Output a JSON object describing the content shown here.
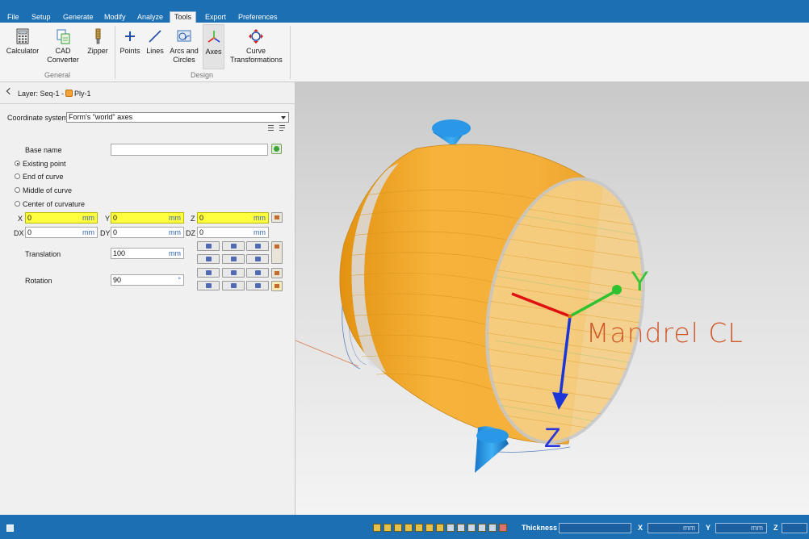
{
  "menu": [
    "File",
    "Setup",
    "Generate",
    "Modify",
    "Analyze",
    "Tools",
    "Export",
    "Preferences"
  ],
  "active_menu": "Tools",
  "ribbon": {
    "general": {
      "label": "General",
      "buttons": [
        {
          "label": "Calculator",
          "icon": "calculator-icon"
        },
        {
          "label": "CAD Converter",
          "icon": "cad-converter-icon"
        },
        {
          "label": "Zipper",
          "icon": "zipper-icon"
        }
      ]
    },
    "design": {
      "label": "Design",
      "buttons": [
        {
          "label": "Points",
          "icon": "plus-icon"
        },
        {
          "label": "Lines",
          "icon": "line-icon"
        },
        {
          "label": "Arcs and Circles",
          "icon": "arcs-icon"
        },
        {
          "label": "Axes",
          "icon": "axes-icon"
        },
        {
          "label": "Curve Transformations",
          "icon": "curve-transform-icon"
        }
      ]
    }
  },
  "breadcrumb": {
    "prefix": "Layer: Seq-1 -",
    "ply": "Ply-1"
  },
  "form": {
    "coord_label": "Coordinate system",
    "coord_value": "Form's \"world\" axes",
    "base_name_label": "Base name",
    "base_name_value": "",
    "options": [
      "Existing point",
      "End of curve",
      "Middle of curve",
      "Center of curvature"
    ],
    "selected_option": "Existing point",
    "x_label": "X",
    "x_value": "0",
    "y_label": "Y",
    "y_value": "0",
    "z_label": "Z",
    "z_value": "0",
    "dx_label": "DX",
    "dx_value": "0",
    "dy_label": "DY",
    "dy_value": "0",
    "dz_label": "DZ",
    "dz_value": "0",
    "unit": "mm",
    "translation_label": "Translation",
    "translation_value": "100",
    "rotation_label": "Rotation",
    "rotation_value": "90",
    "rotation_unit": "°"
  },
  "viewport": {
    "axis_y": "Y",
    "axis_z": "Z",
    "annotation": "Mandrel CL",
    "colors": {
      "mandrel": "#f4a823",
      "cone": "#1f8fe0",
      "x_axis": "#e11010",
      "y_axis": "#2ec22e",
      "z_axis": "#1b35d8",
      "annotation": "#d05a2a"
    }
  },
  "status": {
    "thickness_label": "Thickness",
    "thickness_value": "",
    "x_label": "X",
    "x_unit": "mm",
    "y_label": "Y",
    "y_unit": "mm",
    "z_label": "Z"
  }
}
